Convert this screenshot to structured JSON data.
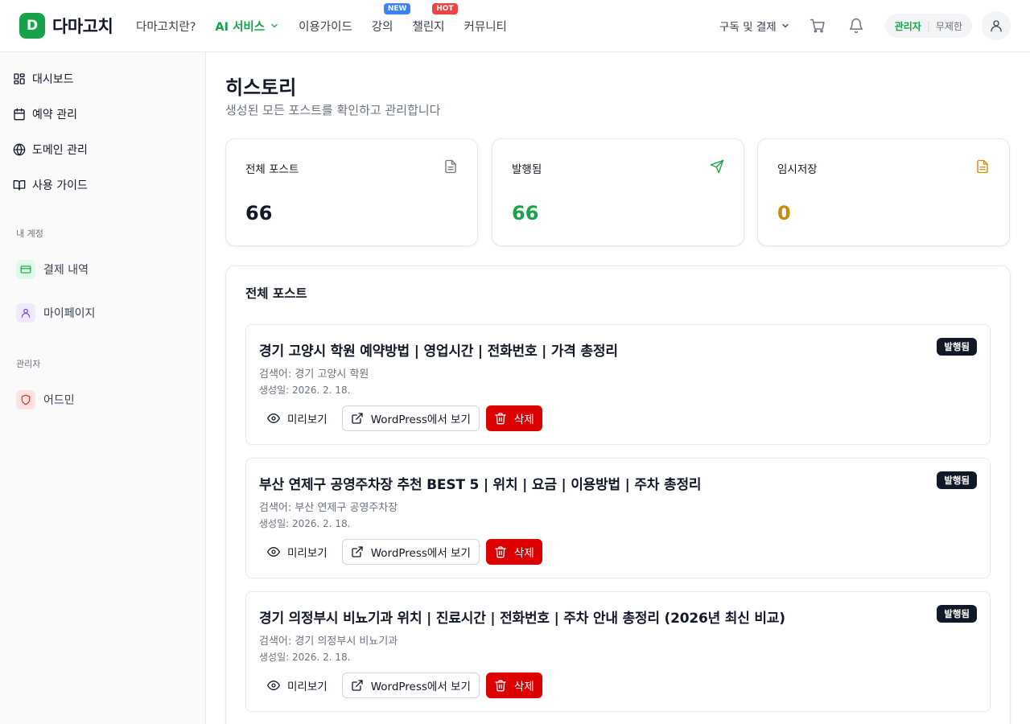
{
  "header": {
    "logo_letter": "D",
    "logo_text": "다마고치",
    "nav": [
      {
        "label": "다마고치란?"
      },
      {
        "label": "AI 서비스"
      },
      {
        "label": "이용가이드"
      },
      {
        "label": "강의",
        "badge": "NEW"
      },
      {
        "label": "챌린지",
        "badge": "HOT"
      },
      {
        "label": "커뮤니티"
      }
    ],
    "subscription_label": "구독 및 결제",
    "role": "관리자",
    "plan": "무제한"
  },
  "sidebar": {
    "items": [
      {
        "label": "대시보드",
        "icon": "dashboard-icon"
      },
      {
        "label": "예약 관리",
        "icon": "calendar-icon"
      },
      {
        "label": "도메인 관리",
        "icon": "globe-icon"
      },
      {
        "label": "사용 가이드",
        "icon": "book-icon"
      }
    ],
    "account_section": "내 계정",
    "account_items": [
      {
        "label": "결제 내역",
        "icon": "credit-card-icon"
      },
      {
        "label": "마이페이지",
        "icon": "user-icon"
      }
    ],
    "admin_section": "관리자",
    "admin_items": [
      {
        "label": "어드민",
        "icon": "shield-icon"
      }
    ]
  },
  "main": {
    "title": "히스토리",
    "subtitle": "생성된 모든 포스트를 확인하고 관리합니다",
    "stats": [
      {
        "label": "전체 포스트",
        "value": "66",
        "color": "#111827",
        "icon": "file-icon"
      },
      {
        "label": "발행됨",
        "value": "66",
        "color": "#16a34a",
        "icon": "send-icon"
      },
      {
        "label": "임시저장",
        "value": "0",
        "color": "#ca8a04",
        "icon": "draft-icon"
      }
    ],
    "list_title": "전체 포스트",
    "posts": [
      {
        "title": "경기 고양시 학원 예약방법 | 영업시간 | 전화번호 | 가격 총정리",
        "status": "발행됨",
        "keyword": "검색어: 경기 고양시 학원",
        "date": "생성일: 2026. 2. 18."
      },
      {
        "title": "부산 연제구 공영주차장 추천 BEST 5 | 위치 | 요금 | 이용방법 | 주차 총정리",
        "status": "발행됨",
        "keyword": "검색어: 부산 연제구 공영주차장",
        "date": "생성일: 2026. 2. 18."
      },
      {
        "title": "경기 의정부시 비뇨기과 위치 | 진료시간 | 전화번호 | 주차 안내 총정리 (2026년 최신 비교)",
        "status": "발행됨",
        "keyword": "검색어: 경기 의정부시 비뇨기과",
        "date": "생성일: 2026. 2. 18."
      }
    ],
    "actions": {
      "preview": "미리보기",
      "wordpress": "WordPress에서 보기",
      "delete": "삭제"
    }
  },
  "colors": {
    "brand": "#16a34a",
    "danger": "#dc0000",
    "draft": "#ca8a04"
  }
}
